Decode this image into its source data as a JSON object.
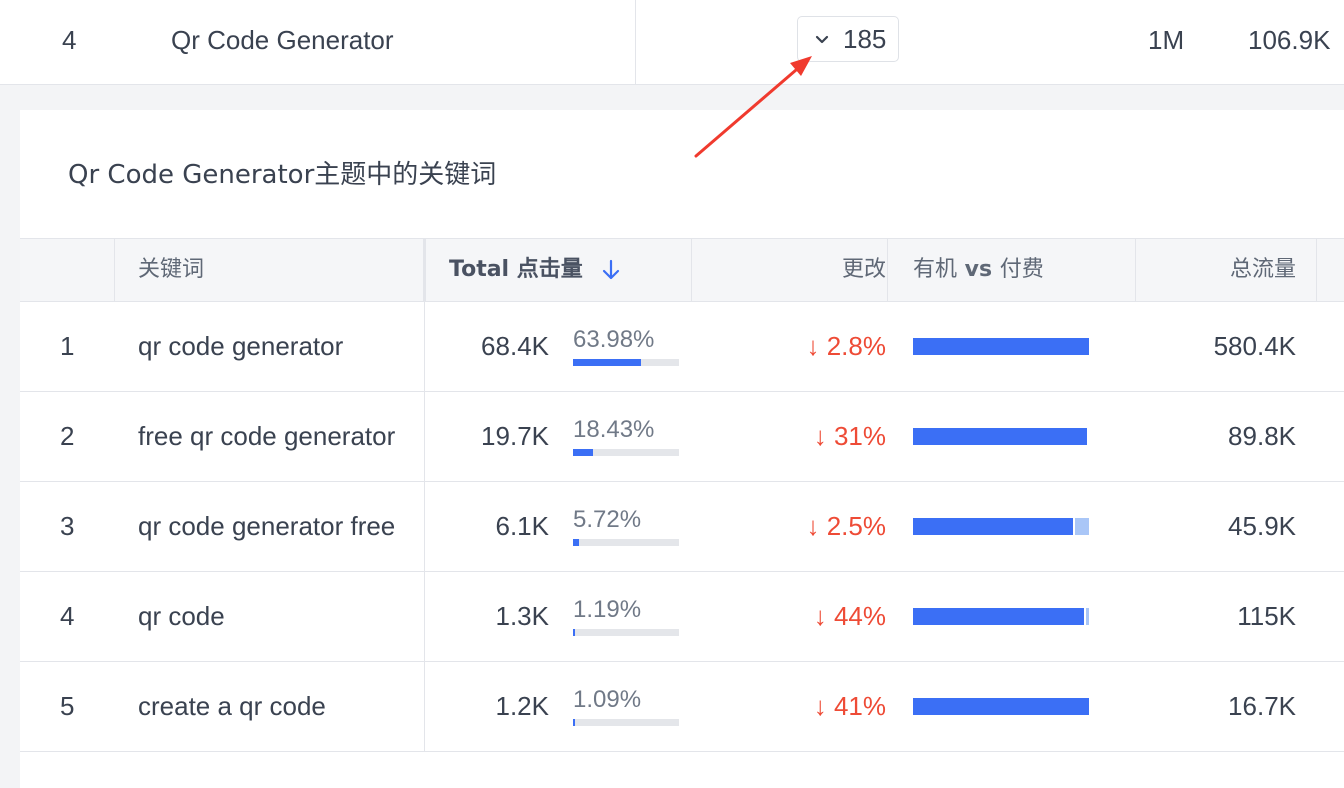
{
  "topic_row": {
    "rank": "4",
    "name": "Qr Code Generator",
    "keyword_count": "185",
    "volume": "1M",
    "traffic": "106.9K"
  },
  "panel": {
    "title": "Qr Code Generator主题中的关键词",
    "headers": {
      "keyword": "关键词",
      "clicks": "Total 点击量",
      "change": "更改",
      "ovp_prefix": "有机",
      "ovp_vs": " vs ",
      "ovp_suffix": "付费",
      "total": "总流量"
    },
    "rows": [
      {
        "rank": "1",
        "keyword": "qr code generator",
        "clicks": "68.4K",
        "share": "63.98%",
        "change": "↓ 2.8%",
        "total": "580.4K"
      },
      {
        "rank": "2",
        "keyword": "free qr code generator",
        "clicks": "19.7K",
        "share": "18.43%",
        "change": "↓ 31%",
        "total": "89.8K"
      },
      {
        "rank": "3",
        "keyword": "qr code generator free",
        "clicks": "6.1K",
        "share": "5.72%",
        "change": "↓ 2.5%",
        "total": "45.9K"
      },
      {
        "rank": "4",
        "keyword": "qr code",
        "clicks": "1.3K",
        "share": "1.19%",
        "change": "↓ 44%",
        "total": "115K"
      },
      {
        "rank": "5",
        "keyword": "create a qr code",
        "clicks": "1.2K",
        "share": "1.09%",
        "change": "↓ 41%",
        "total": "16.7K"
      }
    ],
    "share_fraction": [
      0.6398,
      0.1843,
      0.0572,
      0.0119,
      0.0109
    ],
    "organic_fraction": [
      1.0,
      0.99,
      0.91,
      0.97,
      1.0
    ]
  },
  "colors": {
    "accent_blue": "#3b6ff5",
    "paid_light_blue": "#a9c6f7",
    "decrease_red": "#ee4b36",
    "annotation_arrow": "#f03a2e"
  },
  "icons": {
    "expand": "chevron-down-icon",
    "sort": "arrow-down-icon"
  }
}
